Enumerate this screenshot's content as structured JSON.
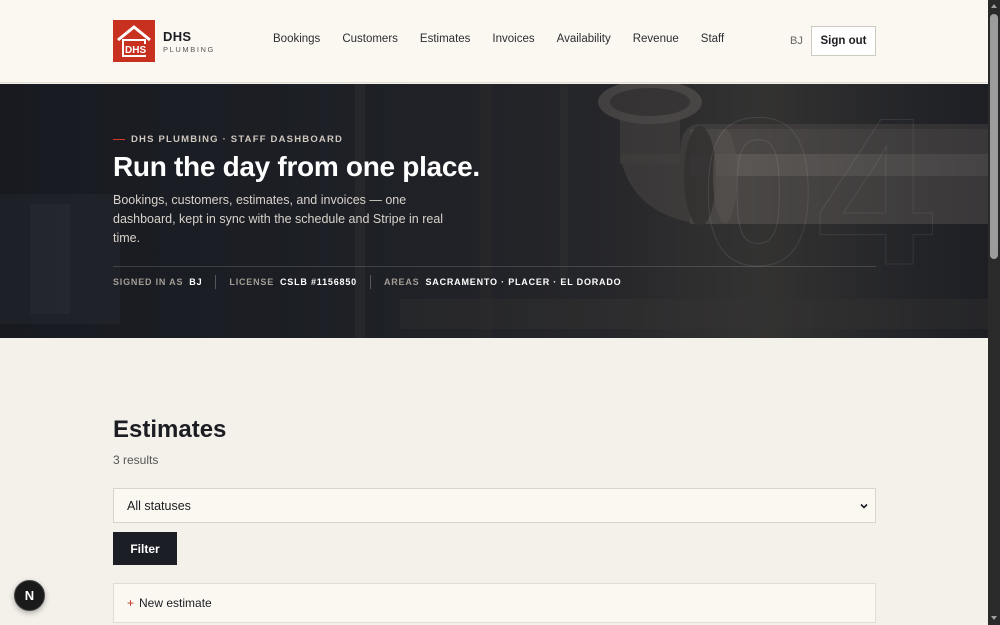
{
  "header": {
    "logo_mark": "DHS",
    "logo_title": "DHS",
    "logo_sub": "PLUMBING",
    "nav": [
      "Bookings",
      "Customers",
      "Estimates",
      "Invoices",
      "Availability",
      "Revenue",
      "Staff"
    ],
    "user_initials": "BJ",
    "signout_label": "Sign out"
  },
  "hero": {
    "eyebrow": "DHS PLUMBING · STAFF DASHBOARD",
    "title": "Run the day from one place.",
    "description": "Bookings, customers, estimates, and invoices — one dashboard, kept in sync with the schedule and Stripe in real time.",
    "meta": [
      {
        "label": "SIGNED IN AS",
        "value": "BJ"
      },
      {
        "label": "LICENSE",
        "value": "CSLB #1156850"
      },
      {
        "label": "AREAS",
        "value": "SACRAMENTO · PLACER · EL DORADO"
      }
    ],
    "watermark": "04"
  },
  "main": {
    "title": "Estimates",
    "results": "3 results",
    "status_select": "All statuses",
    "filter_label": "Filter",
    "new_estimate_label": "New estimate"
  },
  "dev_badge": "N",
  "colors": {
    "brand_red": "#c8301f",
    "dark": "#1b1e25",
    "background": "#f4f0ea"
  }
}
